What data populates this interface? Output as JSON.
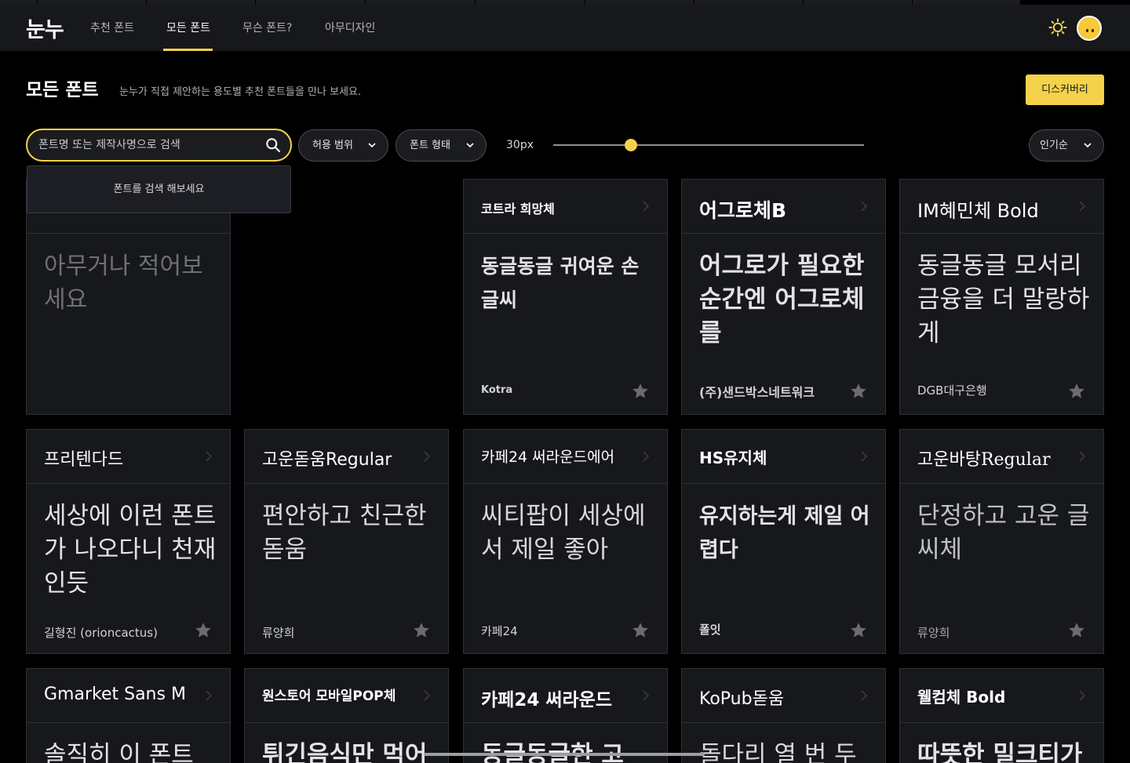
{
  "nav": {
    "logo": "눈누",
    "items": [
      "추천 폰트",
      "모든 폰트",
      "무슨 폰트?",
      "아무디자인"
    ],
    "active_index": 1
  },
  "header": {
    "title": "모든 폰트",
    "subtitle": "눈누가 직접 제안하는 용도별 추천 폰트들을 만나 보세요.",
    "discovery_label": "디스커버리"
  },
  "filters": {
    "search_placeholder": "폰트명 또는 제작사명으로 검색",
    "search_value": "",
    "license_label": "허용 범위",
    "shape_label": "폰트 형태",
    "size_label": "30px",
    "size_fraction": 0.25,
    "sort_label": "인기순",
    "search_hint": "폰트를 검색 해보세요"
  },
  "preview_card": {
    "placeholder": "아무거나 적어보세요"
  },
  "cards": [
    {
      "name": "코트라 희망체",
      "sample": "동글동글 귀여운 손글씨",
      "author": "Kotra"
    },
    {
      "name": "어그로체B",
      "sample": "어그로가 필요한 순간엔 어그로체를",
      "author": "(주)샌드박스네트워크"
    },
    {
      "name": "IM혜민체 Bold",
      "sample": "동글동글 모서리 금융을 더 말랑하게",
      "author": "DGB대구은행"
    },
    {
      "name": "프리텐다드",
      "sample": "세상에 이런 폰트가 나오다니 천재인듯",
      "author": "길형진 (orioncactus)"
    },
    {
      "name": "고운돋움Regular",
      "sample": "편안하고 친근한 돋움",
      "author": "류양희"
    },
    {
      "name": "카페24 써라운드에어",
      "sample": "씨티팝이 세상에서 제일 좋아",
      "author": "카페24"
    },
    {
      "name": "HS유지체",
      "sample": "유지하는게 제일 어렵다",
      "author": "폴잇"
    },
    {
      "name": "고운바탕Regular",
      "sample": "단정하고 고운 글씨체",
      "author": "류양희"
    },
    {
      "name": "Gmarket Sans M",
      "sample": "솔직히 이 폰트",
      "author": ""
    },
    {
      "name": "원스토어 모바일POP체",
      "sample": "튀긴음식만 먹어",
      "author": ""
    },
    {
      "name": "카페24 써라운드",
      "sample": "동글동글한 고",
      "author": ""
    },
    {
      "name": "KoPub돋움",
      "sample": "돌다리 열 번 두",
      "author": ""
    },
    {
      "name": "웰컴체 Bold",
      "sample": "따뜻한 밀크티가",
      "author": ""
    }
  ],
  "colors": {
    "accent": "#f5d24b",
    "background": "#000000",
    "card": "#17181c",
    "star": "#6b6c71"
  },
  "icons": [
    "sun-icon",
    "avatar-icon",
    "search-icon",
    "chevron-down-icon",
    "chevron-right-icon",
    "star-icon"
  ]
}
